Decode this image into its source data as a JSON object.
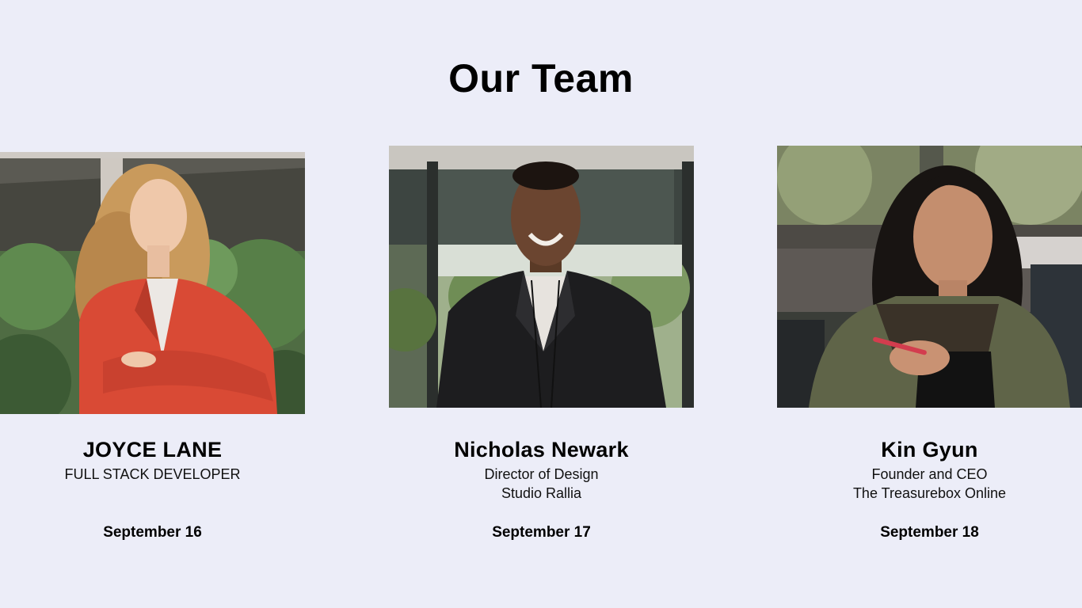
{
  "section": {
    "title": "Our Team"
  },
  "members": [
    {
      "name": "JOYCE LANE",
      "role_line1": "FULL STACK DEVELOPER",
      "role_line2": "",
      "date": "September 16"
    },
    {
      "name": "Nicholas Newark",
      "role_line1": "Director of Design",
      "role_line2": "Studio Rallia",
      "date": "September 17"
    },
    {
      "name": "Kin Gyun",
      "role_line1": "Founder and CEO",
      "role_line2": "The Treasurebox Online",
      "date": "September 18"
    }
  ],
  "colors": {
    "background": "#ecedf8",
    "text": "#000000"
  }
}
